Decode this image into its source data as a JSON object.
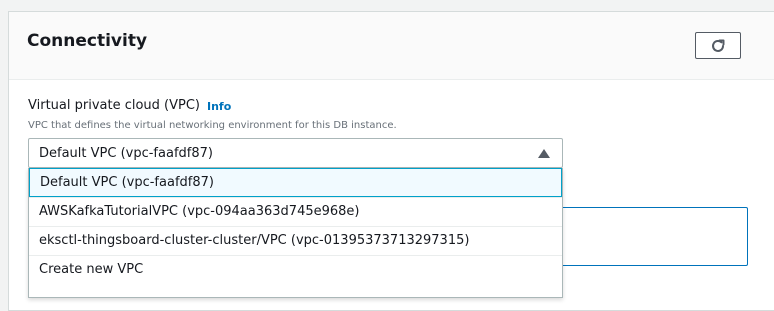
{
  "panel": {
    "title": "Connectivity"
  },
  "toolbar": {
    "refresh_icon": "refresh-icon"
  },
  "vpc": {
    "label": "Virtual private cloud (VPC)",
    "info": "Info",
    "description": "VPC that defines the virtual networking environment for this DB instance.",
    "selected": "Default VPC (vpc-faafdf87)",
    "options": [
      "Default VPC (vpc-faafdf87)",
      "AWSKafkaTutorialVPC (vpc-094aa363d745e968e)",
      "eksctl-thingsboard-cluster-cluster/VPC (vpc-01395373713297315)",
      "Create new VPC"
    ]
  },
  "colors": {
    "link": "#0073bb",
    "selected_border": "#00a1c9"
  }
}
